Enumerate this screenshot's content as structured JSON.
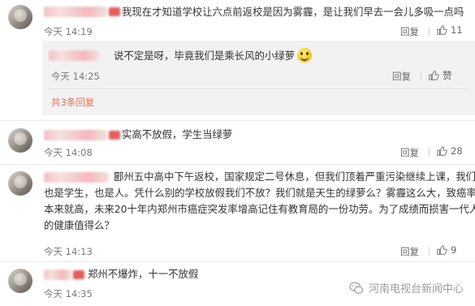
{
  "comments": [
    {
      "text": "我现在才知道学校让六点前返校是因为雾霾，是让我们早去一会儿多吸一点吗",
      "time": "今天 14:19",
      "reply": "回复",
      "likes": "11",
      "sub_reply": {
        "text": "说不定是呀，毕竟我们是乘长风的小绿萝",
        "time": "今天 14:25",
        "reply": "回复",
        "likes": "赞"
      },
      "more": "共3条回复"
    },
    {
      "text": "实高不放假，学生当绿萝",
      "time": "今天 14:08",
      "reply": "回复",
      "likes": "28"
    },
    {
      "text_lines": [
        "郾州五中高中下午返校，国家规定二号休息，但我们顶着严重污染继续上课，我们",
        "也是学生，也是人。凭什么别的学校放假我们不放？我们就是天生的绿萝么？雾霾这么大，致癌率",
        "本来就高，未来20十年内郑州市癌症突发率增高记住有教育局的一份功劳。为了成绩而损害一代人",
        "的健康值得么？"
      ],
      "time": "今天 14:13",
      "reply": "回复",
      "likes": "9"
    },
    {
      "text": "郑州不爆炸，十一不放假",
      "time": "今天 14:35"
    }
  ],
  "watermark": "河南电视台新闻中心",
  "icons": {
    "like": "thumbs-up-icon",
    "emoji": "smile-emoji-icon",
    "logo": "wechat-logo-icon"
  },
  "colors": {
    "link": "#eb7350",
    "subbox": "#f2f2f2"
  }
}
